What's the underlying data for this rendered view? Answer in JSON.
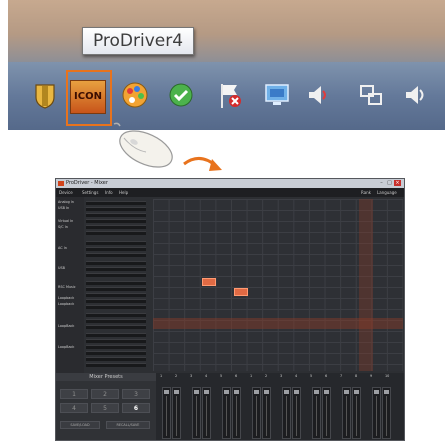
{
  "tooltip": {
    "text": "ProDriver4"
  },
  "tray": {
    "highlighted_icon_label": "ICON",
    "icons": [
      "shield-icon",
      "icon-driver-icon",
      "color-palette-icon",
      "check-security-icon",
      "flag-alert-icon",
      "network-display-icon",
      "volume-icon",
      "network-icon",
      "speaker-icon"
    ]
  },
  "window": {
    "title": "ProDriver - Mixer",
    "menu": [
      "Device",
      "Settings",
      "Info",
      "Help"
    ],
    "menu_right": [
      "Rank",
      "Language"
    ],
    "routing_labels": [
      "Analog In",
      "USB In",
      "",
      "Virtual In",
      "S/C In",
      "",
      "AC In",
      "",
      "USB",
      "",
      "RSC Music",
      "Loopback",
      "Loopback",
      "",
      "LoopBack",
      "",
      "LoopBack"
    ],
    "mixer_presets_title": "Mixer Presets",
    "preset_numbers": [
      "1",
      "2",
      "3",
      "4",
      "5",
      "6"
    ],
    "active_preset": "6",
    "action_buttons": [
      "SAVE/LOAD",
      "RECALL/SAVE"
    ],
    "channel_numbers": [
      "1",
      "2",
      "3",
      "4",
      "5",
      "6",
      "1",
      "2",
      "3",
      "4",
      "5",
      "6",
      "7",
      "8",
      "9",
      "10"
    ]
  },
  "colors": {
    "accent": "#e8731d",
    "node": "#e06a44",
    "window_bg": "#2b2d31"
  }
}
